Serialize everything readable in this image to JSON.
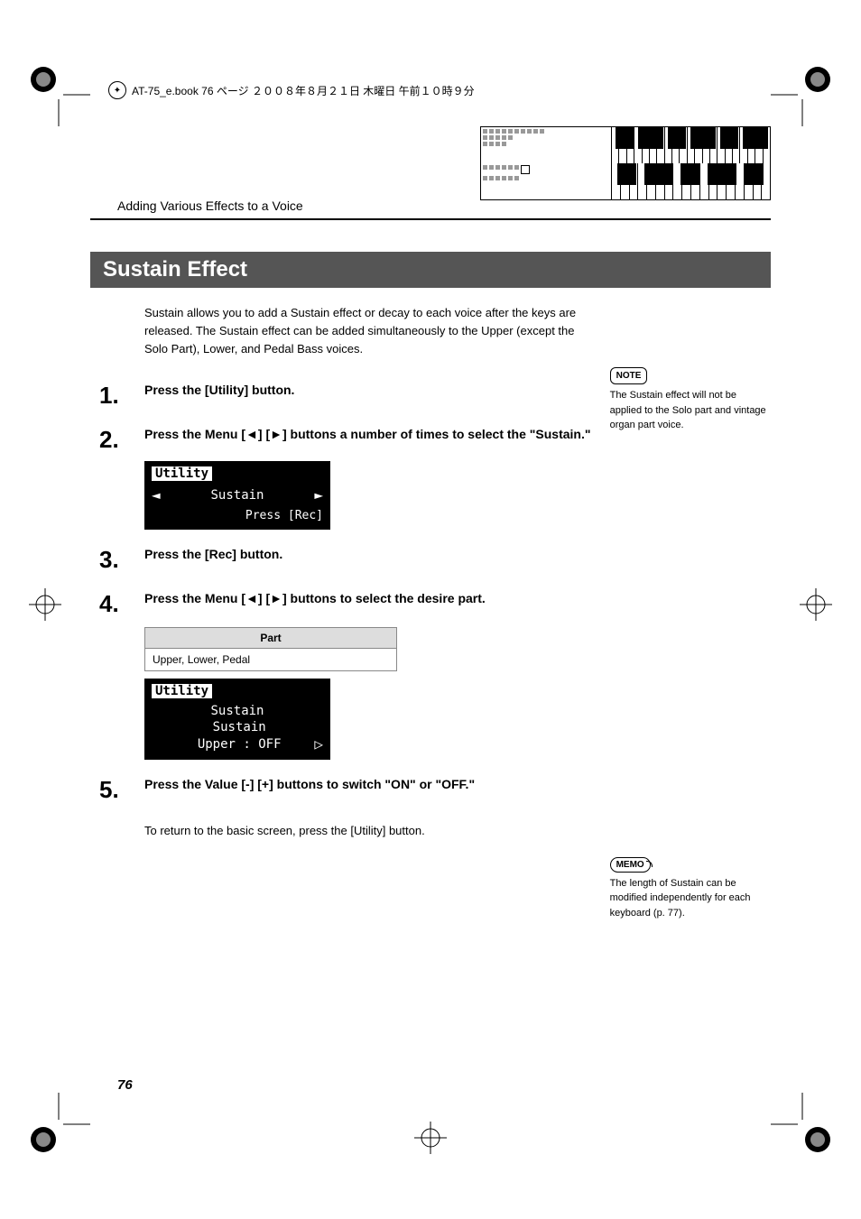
{
  "header": {
    "filename_line": "AT-75_e.book 76 ページ ２００８年８月２１日 木曜日 午前１０時９分"
  },
  "chapter_label": "Adding Various Effects to a Voice",
  "section_title": "Sustain Effect",
  "intro": "Sustain allows you to add a Sustain effect or decay to each voice after the keys are released. The Sustain effect can be added simultaneously to the Upper (except the Solo Part), Lower, and Pedal Bass voices.",
  "steps": {
    "s1": {
      "num": "1.",
      "text": "Press the [Utility] button."
    },
    "s2": {
      "num": "2.",
      "text_a": "Press the Menu [",
      "text_b": "] [",
      "text_c": "] buttons a number of times to select the \"Sustain.\""
    },
    "s3": {
      "num": "3.",
      "text": "Press the [Rec] button."
    },
    "s4": {
      "num": "4.",
      "text_a": "Press the Menu [",
      "text_b": "] [",
      "text_c": "] buttons to select the desire part."
    },
    "s5": {
      "num": "5.",
      "text": "Press the Value [-] [+] buttons to switch \"ON\" or \"OFF.\""
    }
  },
  "lcd1": {
    "title": "Utility",
    "center": "Sustain",
    "bottom": "Press [Rec]"
  },
  "part_table": {
    "header": "Part",
    "row": "Upper, Lower, Pedal"
  },
  "lcd2": {
    "title": "Utility",
    "l1": "Sustain",
    "l2": "Sustain",
    "l3": "Upper : OFF"
  },
  "return_line": "To return to the basic screen, press the [Utility] button.",
  "sidebar": {
    "note_label": "NOTE",
    "note_text": "The Sustain effect will not be applied to the Solo part and vintage organ part voice.",
    "memo_label": "MEMO",
    "memo_text": "The length of Sustain can be modified independently for each keyboard (p. 77)."
  },
  "page_number": "76"
}
